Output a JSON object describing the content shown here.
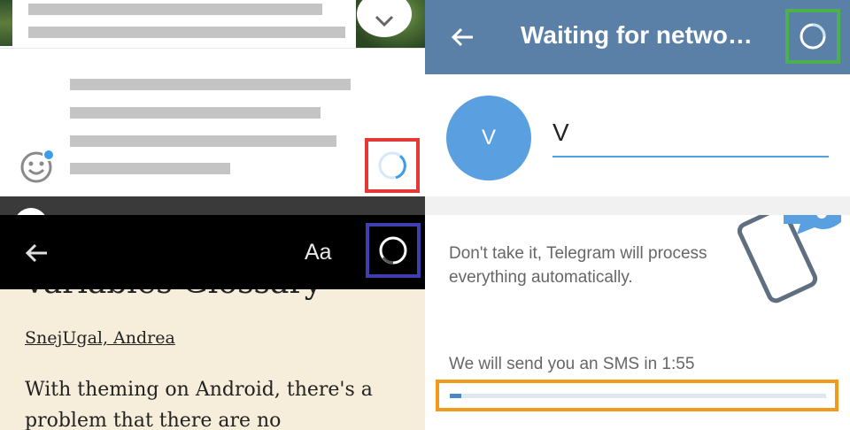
{
  "feed": {
    "icons": {
      "chevron": "chevron-down-icon",
      "emoji": "emoji-icon",
      "spinner": "loading-spinner-icon"
    },
    "colors": {
      "highlight": "#e53935",
      "spinner": "#3d9de6",
      "notification_dot": "#3d9de6"
    }
  },
  "telegram_profile": {
    "title": "Waiting for netwo…",
    "avatar_initial": "V",
    "name_value": "V",
    "icons": {
      "back": "arrow-back-icon",
      "status": "connecting-spinner-icon"
    },
    "colors": {
      "appbar": "#5a80a8",
      "avatar": "#5aa0e0",
      "highlight": "#4caf50",
      "input_underline": "#4ea3e0"
    }
  },
  "reader": {
    "font_button": "Aa",
    "title": "Variables Glossary",
    "authors": "SnejUgal, Andrea",
    "body": "With theming on Android, there's a problem that there are no",
    "icons": {
      "back": "arrow-back-icon",
      "spinner": "loading-spinner-icon"
    },
    "colors": {
      "toolbar": "#000000",
      "background": "#f6eedb",
      "highlight": "#3f3fb0"
    }
  },
  "telegram_sms": {
    "info_text": "Don't take it, Telegram will process everything automatically.",
    "sms_timer_text": "We will send you an SMS in 1:55",
    "progress": 0.03,
    "icons": {
      "illustration": "phone-message-illustration-icon"
    },
    "colors": {
      "highlight": "#f19a1c",
      "progress_fill": "#4b88c4",
      "progress_track": "#dfe7ef"
    }
  }
}
